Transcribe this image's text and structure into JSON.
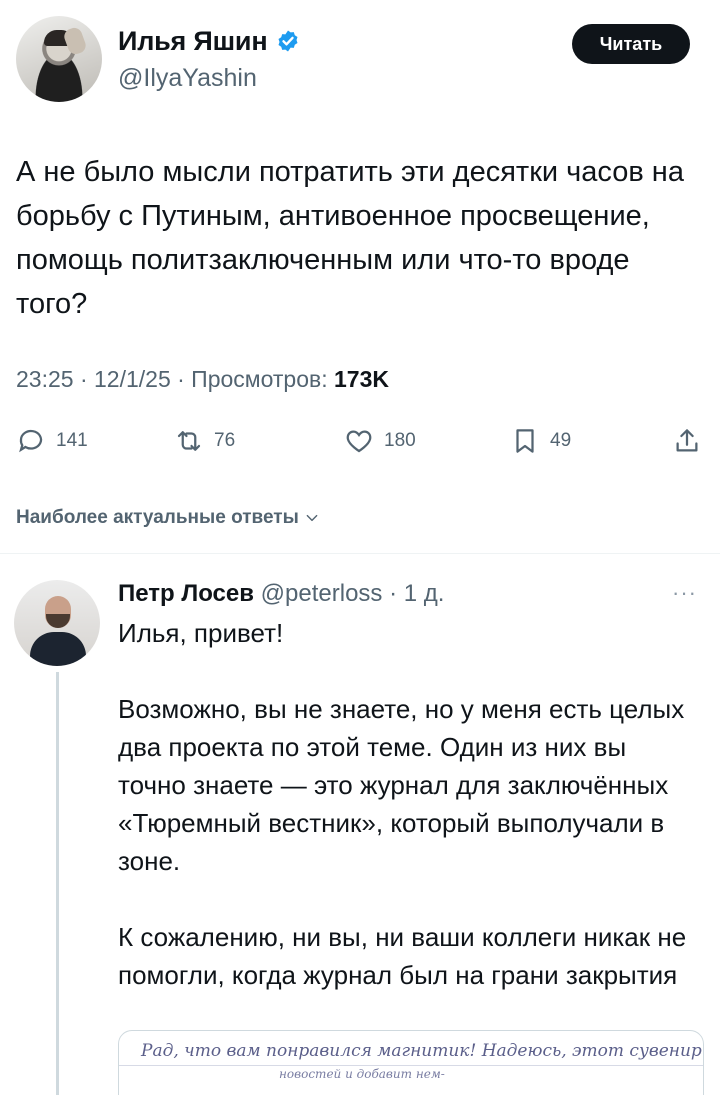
{
  "tweet": {
    "author_name": "Илья Яшин",
    "author_handle": "@IlyaYashin",
    "follow_label": "Читать",
    "text": "А не было мысли потратить эти десятки часов на борьбу с Путиным, антивоенное просвещение, помощь политзаключенным или что-то вроде того?",
    "time": "23:25 · 12/1/25 · Просмотров: ",
    "views": "173K",
    "replies": "141",
    "reposts": "76",
    "likes": "180",
    "bookmarks": "49"
  },
  "sort_label": "Наиболее актуальные ответы",
  "reply": {
    "author_name": "Петр Лосев",
    "author_handle": "@peterloss",
    "time": "· 1 д.",
    "more": "···",
    "text": "Илья, привет!\n\nВозможно, вы не знаете, но у меня есть целых два проекта по этой теме. Один из них вы точно знаете — это журнал для заключённых «Тюремный вестник», который выполучали в зоне.\n\nК сожалению, ни вы, ни ваши коллеги никак не помогли, когда журнал был на грани закрытия",
    "image_text_line1": "Рад, что вам понравился магнитик! Надеюсь, этот сувенир",
    "image_text_line2": "новостей и добавит нем-"
  },
  "icons": {
    "verified": "verified-badge-icon",
    "reply": "reply-bubble-icon",
    "repost": "repost-icon",
    "like": "heart-icon",
    "bookmark": "bookmark-icon",
    "share": "share-icon",
    "sort": "chevron-down-icon"
  },
  "colors": {
    "verified": "#1d9bf0",
    "text": "#0f1419",
    "secondary": "#536471"
  }
}
